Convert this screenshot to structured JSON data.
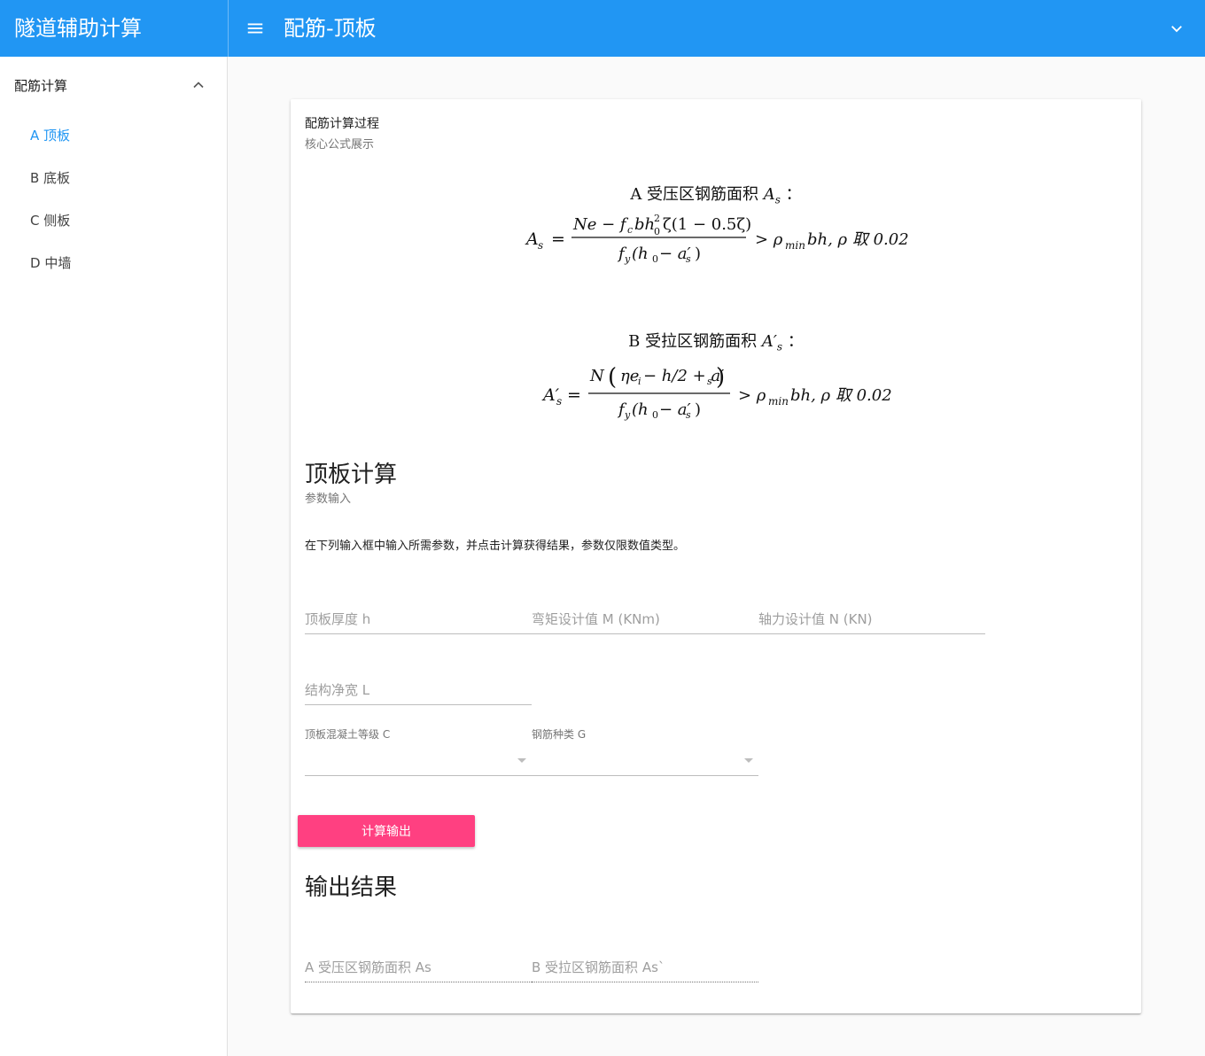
{
  "app": {
    "title": "隧道辅助计算",
    "page_title": "配筋-顶板"
  },
  "sidebar": {
    "group_label": "配筋计算",
    "items": [
      {
        "label": "A 顶板",
        "active": true
      },
      {
        "label": "B 底板",
        "active": false
      },
      {
        "label": "C 侧板",
        "active": false
      },
      {
        "label": "D 中墙",
        "active": false
      }
    ]
  },
  "card": {
    "title": "配筋计算过程",
    "subtitle": "核心公式展示",
    "formula_a": {
      "title": "A 受压区钢筋面积 ",
      "title_symbol": "A",
      "title_sub": "s",
      "colon": "：",
      "lhs": "A",
      "lhs_sub": "s",
      "numerator": "Ne − f",
      "numerator_tail": "bh",
      "numerator_end": "ζ(1 − 0.5ζ)",
      "denominator": "f",
      "denominator_tail": "(h",
      "denominator_end": " − a′",
      "condition": "> ρ",
      "condition_sub": "min",
      "condition_tail": "bh,  ρ 取 0.02"
    },
    "formula_b": {
      "title": "B 受拉区钢筋面积 ",
      "title_symbol": "A′",
      "title_sub": "s",
      "colon": "：",
      "lhs": "A′",
      "lhs_sub": "s",
      "numerator": "N",
      "numerator_inner": "ηe",
      "numerator_rest": " − h/2 + a′",
      "denominator": "f",
      "denominator_tail": "(h",
      "denominator_end": " − a′",
      "condition": "> ρ",
      "condition_sub": "min",
      "condition_tail": "bh,  ρ 取 0.02"
    },
    "calc_section": {
      "title": "顶板计算",
      "subtitle": "参数输入",
      "instructions": "在下列输入框中输入所需参数，并点击计算获得结果，参数仅限数值类型。"
    },
    "inputs": {
      "thickness": "顶板厚度 h",
      "moment": "弯矩设计值 M (KNm)",
      "axial": "轴力设计值 N (KN)",
      "span": "结构净宽 L",
      "concrete_grade": "顶板混凝土等级 C",
      "rebar_type": "钢筋种类 G"
    },
    "button_label": "计算输出",
    "output_section": {
      "title": "输出结果",
      "as_label": "A 受压区钢筋面积 As",
      "as_prime_label": "B 受拉区钢筋面积 As`"
    }
  }
}
